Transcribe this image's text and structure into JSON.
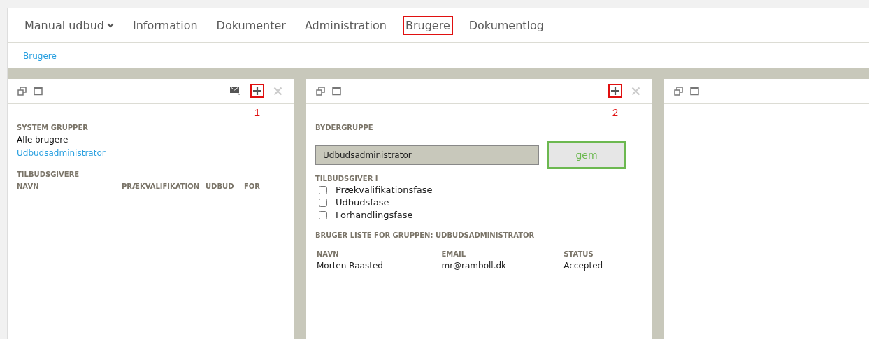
{
  "nav": {
    "tabs": [
      {
        "label": "Manual udbud",
        "dropdown": true,
        "highlighted": false
      },
      {
        "label": "Information",
        "dropdown": false,
        "highlighted": false
      },
      {
        "label": "Dokumenter",
        "dropdown": false,
        "highlighted": false
      },
      {
        "label": "Administration",
        "dropdown": false,
        "highlighted": false
      },
      {
        "label": "Brugere",
        "dropdown": false,
        "highlighted": true
      },
      {
        "label": "Dokumentlog",
        "dropdown": false,
        "highlighted": false
      }
    ]
  },
  "breadcrumb": "Brugere",
  "panels": [
    {
      "kind": "groups",
      "actions": [
        {
          "kind": "mail",
          "disabled": false,
          "highlighted": false
        },
        {
          "kind": "add",
          "disabled": false,
          "highlighted": true,
          "callout": "1"
        },
        {
          "kind": "close",
          "disabled": true,
          "highlighted": false
        }
      ],
      "system_groups": {
        "title": "SYSTEM GRUPPER",
        "items": [
          {
            "label": "Alle brugere",
            "selected": false
          },
          {
            "label": "Udbudsadministrator",
            "selected": true
          }
        ]
      },
      "bidders": {
        "title": "TILBUDSGIVERE",
        "columns": [
          "NAVN",
          "PRÆKVALIFIKATION",
          "UDBUD",
          "FOR"
        ]
      }
    },
    {
      "kind": "editor",
      "actions": [
        {
          "kind": "add",
          "disabled": false,
          "highlighted": true,
          "callout": "2"
        },
        {
          "kind": "close",
          "disabled": true,
          "highlighted": false
        }
      ],
      "group_label": "BYDERGRUPPE",
      "group_value": "Udbudsadministrator",
      "save_button": "gem",
      "phases_title": "TILBUDSGIVER I",
      "phases": [
        {
          "label": "Prækvalifikationsfase",
          "checked": false
        },
        {
          "label": "Udbudsfase",
          "checked": false
        },
        {
          "label": "Forhandlingsfase",
          "checked": false
        }
      ],
      "users_title": "BRUGER LISTE FOR GRUPPEN: UDBUDSADMINISTRATOR",
      "users": {
        "columns": [
          "NAVN",
          "EMAIL",
          "STATUS"
        ],
        "rows": [
          [
            "Morten Raasted",
            "mr@ramboll.dk",
            "Accepted"
          ]
        ]
      }
    },
    {
      "kind": "empty"
    }
  ]
}
